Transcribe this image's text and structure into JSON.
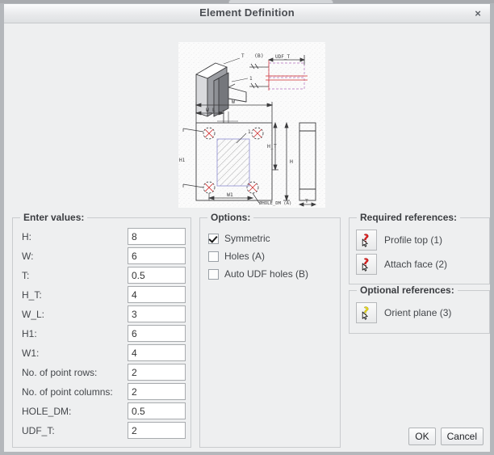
{
  "window": {
    "title": "Element Definition",
    "close_label": "×"
  },
  "preview": {
    "alt": "udf-element-technical-drawing",
    "annotations": {
      "section_label": "(B)",
      "section_dim": "UDF_T",
      "width_dim": "W",
      "width_left_dim": "W_L",
      "width_bottom_dim": "W1",
      "height_dim": "H",
      "height_top_dim": "H_T",
      "height_side_dim": "H1",
      "thickness_dim": "T",
      "hole_note": "ØHOLE_DM (A)"
    }
  },
  "values_group": {
    "legend": "Enter values:",
    "fields": [
      {
        "label": "H:",
        "value": "8",
        "name": "h"
      },
      {
        "label": "W:",
        "value": "6",
        "name": "w"
      },
      {
        "label": "T:",
        "value": "0.5",
        "name": "t"
      },
      {
        "label": "H_T:",
        "value": "4",
        "name": "h-t"
      },
      {
        "label": "W_L:",
        "value": "3",
        "name": "w-l"
      },
      {
        "label": "H1:",
        "value": "6",
        "name": "h1"
      },
      {
        "label": "W1:",
        "value": "4",
        "name": "w1"
      },
      {
        "label": "No. of point rows:",
        "value": "2",
        "name": "point-rows"
      },
      {
        "label": "No. of point columns:",
        "value": "2",
        "name": "point-columns"
      },
      {
        "label": "HOLE_DM:",
        "value": "0.5",
        "name": "hole-dm"
      },
      {
        "label": "UDF_T:",
        "value": "2",
        "name": "udf-t"
      }
    ]
  },
  "options_group": {
    "legend": "Options:",
    "items": [
      {
        "label": "Symmetric",
        "checked": true,
        "name": "symmetric"
      },
      {
        "label": "Holes (A)",
        "checked": false,
        "name": "holes-a"
      },
      {
        "label": "Auto UDF holes (B)",
        "checked": false,
        "name": "auto-udf-holes-b"
      }
    ]
  },
  "required_refs_group": {
    "legend": "Required references:",
    "items": [
      {
        "label": "Profile top (1)",
        "icon": "reference-picker-icon",
        "color": "#e02020",
        "name": "profile-top"
      },
      {
        "label": "Attach face (2)",
        "icon": "reference-picker-icon",
        "color": "#e02020",
        "name": "attach-face"
      }
    ]
  },
  "optional_refs_group": {
    "legend": "Optional references:",
    "items": [
      {
        "label": "Orient plane (3)",
        "icon": "reference-picker-icon",
        "color": "#e8d81a",
        "name": "orient-plane"
      }
    ]
  },
  "footer": {
    "ok_label": "OK",
    "cancel_label": "Cancel"
  },
  "colors": {
    "dialog_bg": "#eeeff0",
    "frame": "#b4b7bb",
    "titlebar_top": "#fcfcfd",
    "titlebar_bottom": "#dfe1e3",
    "field_bg": "#ffffff",
    "field_border": "#a8abae",
    "group_border": "#c9cbce",
    "text": "#44474b",
    "required_icon": "#e02020",
    "optional_icon": "#e8d81a"
  }
}
